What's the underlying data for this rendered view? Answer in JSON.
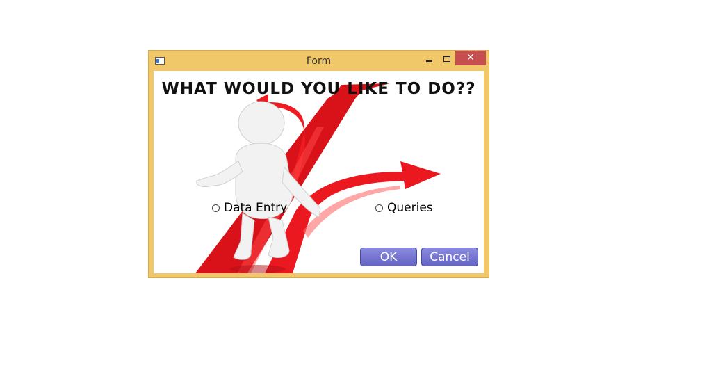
{
  "window": {
    "title": "Form",
    "close_label": "✕",
    "icons": [
      "app-icon",
      "minimize-icon",
      "maximize-icon",
      "close-icon"
    ]
  },
  "form": {
    "heading": "WHAT WOULD YOU LIKE TO DO??",
    "options": [
      {
        "label": "Data Entry",
        "selected": false
      },
      {
        "label": "Queries",
        "selected": false
      }
    ],
    "ok_label": "OK",
    "cancel_label": "Cancel"
  },
  "colors": {
    "window_frame": "#f0c86a",
    "close_button": "#c74e4e",
    "button_fill": "#7474d4",
    "arrow_red": "#e8141a"
  }
}
